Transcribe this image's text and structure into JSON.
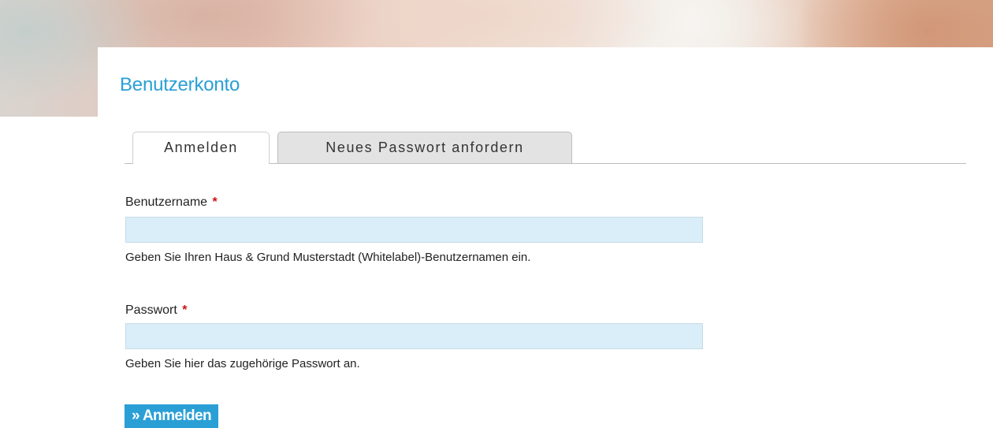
{
  "page": {
    "title": "Benutzerkonto"
  },
  "tabs": [
    {
      "label": "Anmelden",
      "active": true
    },
    {
      "label": "Neues Passwort anfordern",
      "active": false
    }
  ],
  "form": {
    "username": {
      "label": "Benutzername",
      "required_marker": "*",
      "value": "",
      "help": "Geben Sie Ihren Haus & Grund Musterstadt (Whitelabel)-Benutzernamen ein."
    },
    "password": {
      "label": "Passwort",
      "required_marker": "*",
      "value": "",
      "help": "Geben Sie hier das zugehörige Passwort an."
    },
    "submit_label": "» Anmelden"
  },
  "colors": {
    "accent": "#2a9fd6",
    "input_background": "#d9eef9",
    "required": "#cc1111",
    "inactive_tab": "#e3e3e3"
  }
}
